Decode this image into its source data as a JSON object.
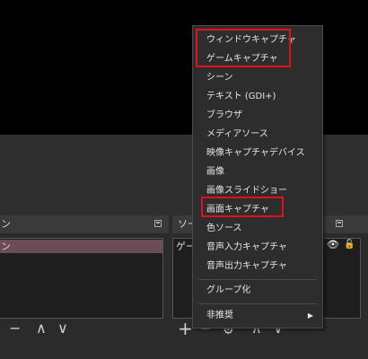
{
  "scenes_dock": {
    "title_suffix": "ン",
    "selected_scene_suffix": "ン"
  },
  "sources_dock": {
    "title_prefix": "ソー",
    "first_source_prefix": "ゲー"
  },
  "toolbar": {
    "scenes": {
      "remove_glyph": "−",
      "up_glyph": "∧",
      "down_glyph": "∨"
    },
    "sources": {
      "add_glyph": "+",
      "remove_glyph": "−",
      "settings_glyph": "⚙",
      "up_glyph": "∧",
      "down_glyph": "∨"
    }
  },
  "icons": {
    "visibility": "👁",
    "lock": "🔓"
  },
  "context_menu": {
    "items": [
      "ウィンドウキャプチャ",
      "ゲームキャプチャ",
      "シーン",
      "テキスト (GDI+)",
      "ブラウザ",
      "メディアソース",
      "映像キャプチャデバイス",
      "画像",
      "画像スライドショー",
      "画面キャプチャ",
      "色ソース",
      "音声入力キャプチャ",
      "音声出力キャプチャ",
      "グループ化",
      "非推奨"
    ],
    "submenu_arrow": "▶"
  },
  "annotation": {
    "highlight_color": "#e0101e"
  }
}
